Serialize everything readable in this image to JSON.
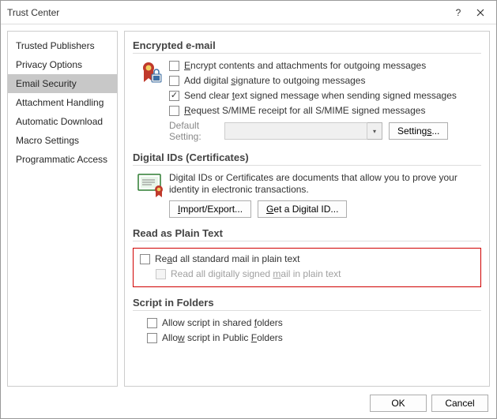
{
  "window": {
    "title": "Trust Center"
  },
  "sidebar": {
    "items": [
      {
        "label": "Trusted Publishers",
        "selected": false
      },
      {
        "label": "Privacy Options",
        "selected": false
      },
      {
        "label": "Email Security",
        "selected": true
      },
      {
        "label": "Attachment Handling",
        "selected": false
      },
      {
        "label": "Automatic Download",
        "selected": false
      },
      {
        "label": "Macro Settings",
        "selected": false
      },
      {
        "label": "Programmatic Access",
        "selected": false
      }
    ]
  },
  "encrypted": {
    "title": "Encrypted e-mail",
    "opt_encrypt_prefix": "E",
    "opt_encrypt_rest": "ncrypt contents and attachments for outgoing messages",
    "opt_encrypt_checked": false,
    "opt_sign_prefix": "Add digital ",
    "opt_sign_u": "s",
    "opt_sign_rest": "ignature to outgoing messages",
    "opt_sign_checked": false,
    "opt_clear_prefix": "Send clear ",
    "opt_clear_u": "t",
    "opt_clear_rest": "ext signed message when sending signed messages",
    "opt_clear_checked": true,
    "opt_receipt_u": "R",
    "opt_receipt_rest": "equest S/MIME receipt for all S/MIME signed messages",
    "opt_receipt_checked": false,
    "default_label_line1": "Default",
    "default_label_line2": "Setting:",
    "dropdown_value": "",
    "settings_btn_prefix": "Setting",
    "settings_btn_u": "s",
    "settings_btn_suffix": "..."
  },
  "digital": {
    "title": "Digital IDs (Certificates)",
    "desc": "Digital IDs or Certificates are documents that allow you to prove your identity in electronic transactions.",
    "import_u": "I",
    "import_rest": "mport/Export...",
    "getid_prefix": "",
    "getid_u": "G",
    "getid_rest": "et a Digital ID..."
  },
  "plain": {
    "title": "Read as Plain Text",
    "opt_all_prefix": "Re",
    "opt_all_u": "a",
    "opt_all_rest": "d all standard mail in plain text",
    "opt_all_checked": false,
    "opt_signed_prefix": "Read all digitally signed ",
    "opt_signed_u": "m",
    "opt_signed_rest": "ail in plain text",
    "opt_signed_disabled": true
  },
  "script": {
    "title": "Script in Folders",
    "opt_shared_prefix": "Allow script in shared ",
    "opt_shared_u": "f",
    "opt_shared_rest": "olders",
    "opt_shared_checked": false,
    "opt_public_prefix": "Allo",
    "opt_public_u": "w",
    "opt_public_mid": " script in Public ",
    "opt_public_u2": "F",
    "opt_public_rest": "olders",
    "opt_public_checked": false
  },
  "footer": {
    "ok": "OK",
    "cancel": "Cancel"
  }
}
